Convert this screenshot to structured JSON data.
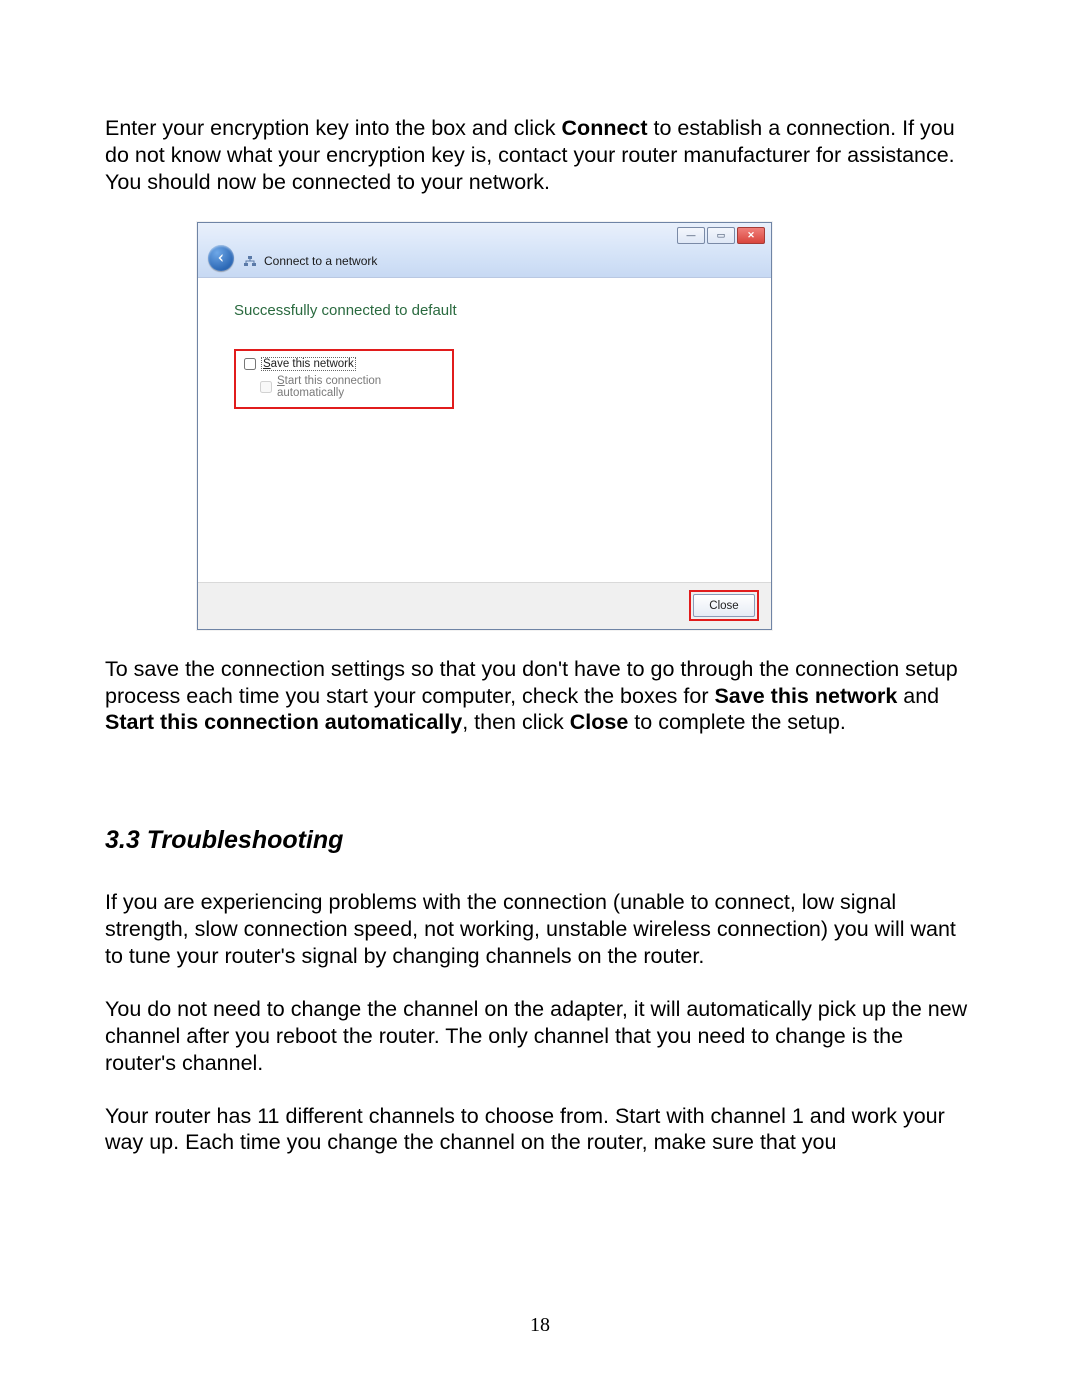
{
  "para1": {
    "seg1": "Enter your encryption key into the box and click ",
    "bold1": "Connect",
    "seg2": " to establish a connection.  If you do not know what your encryption key is, contact your router manufacturer for assistance."
  },
  "para2": "You should now be connected to your network.",
  "dialog": {
    "title": "Connect to a network",
    "success": "Successfully connected to default",
    "save_prefix": "S",
    "save_rest": "ave this network",
    "auto_prefix": "S",
    "auto_rest": "tart this connection automatically",
    "close_label": "Close",
    "min_glyph": "—",
    "max_glyph": "▭",
    "close_glyph": "✕"
  },
  "para3": {
    "seg1": "To save the connection settings so that you don't have to go through the connection setup process each time you start your computer, check the boxes for ",
    "bold1": "Save this network",
    "seg2": " and ",
    "bold2": "Start this connection automatically",
    "seg3": ", then click ",
    "bold3": "Close",
    "seg4": " to complete the setup."
  },
  "heading": "3.3 Troubleshooting",
  "para4": "If you are experiencing problems with the connection (unable to connect, low signal strength, slow connection speed, not working, unstable wireless connection) you will want to tune your router's signal by changing channels on the router.",
  "para5": "You do not need to change the channel on the adapter, it will automatically pick up the new channel after you reboot the router.  The only channel that you need to change is the router's channel.",
  "para6": "Your router has 11 different channels to choose from.  Start with channel 1 and work your way up.  Each time you change the channel on the router, make sure that you",
  "page_number": "18"
}
